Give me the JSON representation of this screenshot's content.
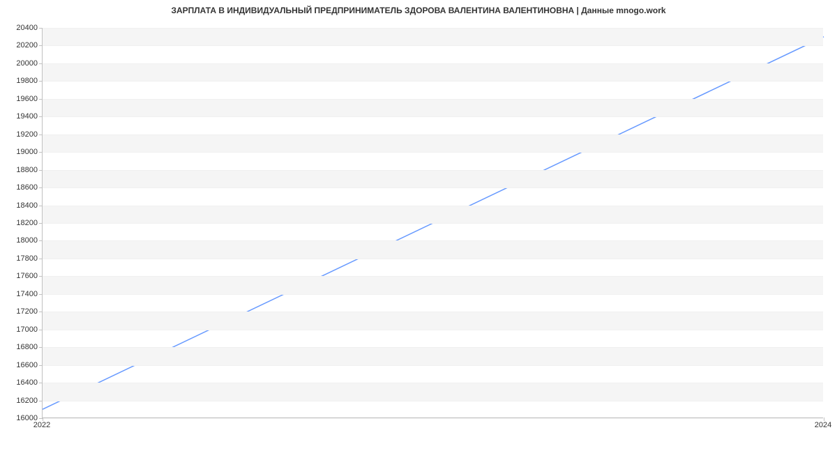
{
  "chart_data": {
    "type": "line",
    "title": "ЗАРПЛАТА В ИНДИВИДУАЛЬНЫЙ ПРЕДПРИНИМАТЕЛЬ ЗДОРОВА ВАЛЕНТИНА ВАЛЕНТИНОВНА | Данные mnogo.work",
    "x": [
      2022,
      2024
    ],
    "series": [
      {
        "name": "salary",
        "values": [
          16100,
          20300
        ],
        "color": "#6699ff"
      }
    ],
    "x_ticks": [
      2022,
      2024
    ],
    "y_ticks": [
      16000,
      16200,
      16400,
      16600,
      16800,
      17000,
      17200,
      17400,
      17600,
      17800,
      18000,
      18200,
      18400,
      18600,
      18800,
      19000,
      19200,
      19400,
      19600,
      19800,
      20000,
      20200,
      20400
    ],
    "xlim": [
      2022,
      2024
    ],
    "ylim": [
      16000,
      20400
    ],
    "xlabel": "",
    "ylabel": ""
  }
}
